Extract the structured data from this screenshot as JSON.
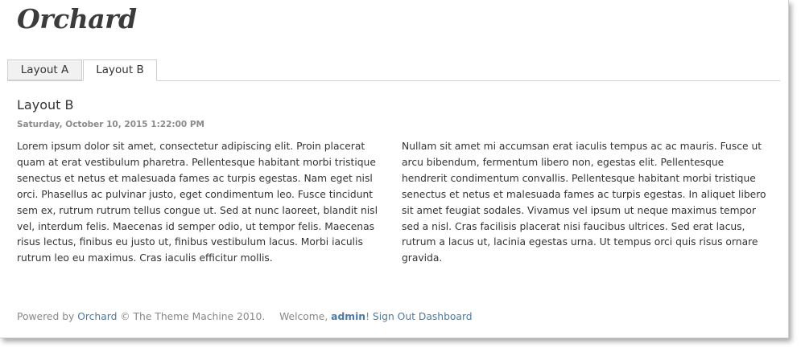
{
  "brand": {
    "logo": "Orchard"
  },
  "tabs": [
    {
      "label": "Layout A",
      "active": false
    },
    {
      "label": "Layout B",
      "active": true
    }
  ],
  "content": {
    "title": "Layout B",
    "date": "Saturday, October 10, 2015 1:22:00 PM",
    "column_left": "Lorem ipsum dolor sit amet, consectetur adipiscing elit. Proin placerat quam at erat vestibulum pharetra. Pellentesque habitant morbi tristique senectus et netus et malesuada fames ac turpis egestas. Nam eget nisl orci. Phasellus ac pulvinar justo, eget condimentum leo. Fusce tincidunt sem ex, rutrum rutrum tellus congue ut. Sed at nunc laoreet, blandit nisl vel, interdum felis. Maecenas id semper odio, ut tempor felis. Maecenas risus lectus, finibus eu justo ut, finibus vestibulum lacus. Morbi iaculis rutrum leo eu maximus. Cras iaculis efficitur mollis.",
    "column_right": "Nullam sit amet mi accumsan erat iaculis tempus ac ac mauris. Fusce ut arcu bibendum, fermentum libero non, egestas elit. Pellentesque hendrerit condimentum convallis. Pellentesque habitant morbi tristique senectus et netus et malesuada fames ac turpis egestas. In aliquet libero sit amet feugiat sodales. Vivamus vel ipsum ut neque maximus tempor sed a nisl. Cras facilisis placerat nisi faucibus ultrices. Sed erat lacus, rutrum a lacus ut, lacinia egestas urna. Ut tempus orci quis risus ornare gravida."
  },
  "footer": {
    "powered_by": "Powered by",
    "orchard_link": "Orchard",
    "copyright": "© The Theme Machine 2010.",
    "welcome": "Welcome,",
    "username": "admin",
    "exclaim": "!",
    "sign_out": "Sign Out",
    "dashboard": "Dashboard"
  },
  "colors": {
    "link": "#4a7aa5",
    "text": "#333333",
    "muted": "#888888",
    "tab_inactive_bg": "#f1f1f1"
  }
}
